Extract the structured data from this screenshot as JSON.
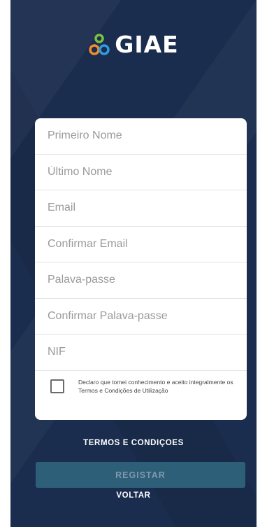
{
  "logo": {
    "text": "GIAE"
  },
  "form": {
    "first_name": {
      "placeholder": "Primeiro Nome",
      "value": ""
    },
    "last_name": {
      "placeholder": "Último Nome",
      "value": ""
    },
    "email": {
      "placeholder": "Email",
      "value": ""
    },
    "confirm_email": {
      "placeholder": "Confirmar Email",
      "value": ""
    },
    "password": {
      "placeholder": "Palava-passe",
      "value": ""
    },
    "confirm_password": {
      "placeholder": "Confirmar Palava-passe",
      "value": ""
    },
    "nif": {
      "placeholder": "NIF",
      "value": ""
    },
    "terms_checkbox": {
      "checked": false,
      "label": "Declaro que tomei conhecimento e aceito integralmente os Termos e Condições de Utilização"
    }
  },
  "links": {
    "terms": "TERMOS E CONDIÇOES",
    "back": "VOLTAR"
  },
  "buttons": {
    "register": "REGISTAR"
  },
  "colors": {
    "background": "#1b2d4f",
    "register_button": "#2e5f78",
    "logo_orange": "#f28c28",
    "logo_blue": "#2f9be0",
    "logo_green": "#7cc242"
  }
}
